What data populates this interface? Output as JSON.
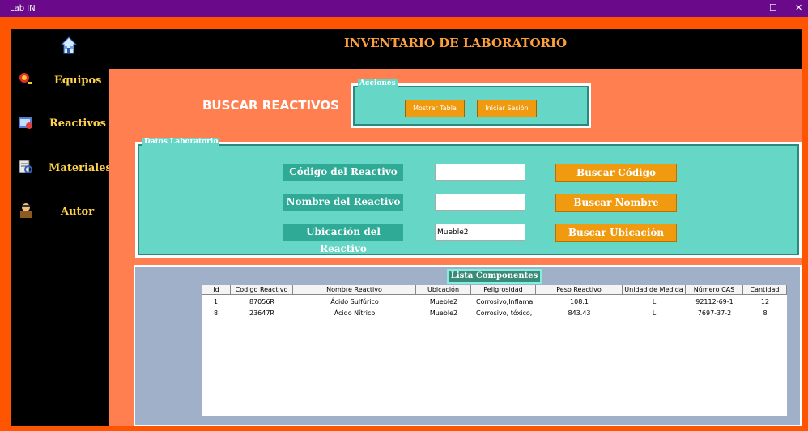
{
  "window": {
    "title": "Lab IN",
    "maximize_glyph": "☐",
    "close_glyph": "✕"
  },
  "header": {
    "title": "INVENTARIO DE LABORATORIO"
  },
  "sidebar": {
    "items": [
      {
        "label": "Equipos",
        "icon": "microscope-icon"
      },
      {
        "label": "Reactivos",
        "icon": "chemistry-icon"
      },
      {
        "label": "Materiales",
        "icon": "materials-icon"
      },
      {
        "label": "Autor",
        "icon": "author-icon"
      }
    ]
  },
  "page": {
    "title": "BUSCAR REACTIVOS"
  },
  "acciones": {
    "title": "Acciones",
    "mostrar_tabla": "Mostrar Tabla",
    "iniciar_sesion": "Iniciar Sesión"
  },
  "datos": {
    "title": "Datos Laboratorio",
    "codigo_label": "Código del Reactivo",
    "nombre_label": "Nombre del Reactivo",
    "ubicacion_label": "Ubicación del Reactivo",
    "codigo_value": "",
    "nombre_value": "",
    "ubicacion_value": "Mueble2",
    "buscar_codigo": "Buscar Código",
    "buscar_nombre": "Buscar Nombre",
    "buscar_ubicacion": "Buscar Ubicación"
  },
  "lista": {
    "title": "Lista Componentes",
    "columns": [
      "Id",
      "Codigo Reactivo",
      "Nombre Reactivo",
      "Ubicación",
      "Peligrosidad",
      "Peso Reactivo",
      "Unidad de Medida",
      "Número CAS",
      "Cantidad"
    ],
    "rows": [
      [
        "1",
        "87056R",
        "Ácido Sulfúrico",
        "Mueble2",
        "Corrosivo,Inflama",
        "108.1",
        "L",
        "92112-69-1",
        "12"
      ],
      [
        "8",
        "23647R",
        "Ácido Nítrico",
        "Mueble2",
        "Corrosivo, tóxico,",
        "843.43",
        "L",
        "7697-37-2",
        "8"
      ]
    ]
  },
  "colors": {
    "titlebar": "#6a0a8a",
    "frame": "#ff5500",
    "sidebar": "#000000",
    "accent": "#66d6c6",
    "button": "#f09a10",
    "header_text": "#ffa040"
  }
}
